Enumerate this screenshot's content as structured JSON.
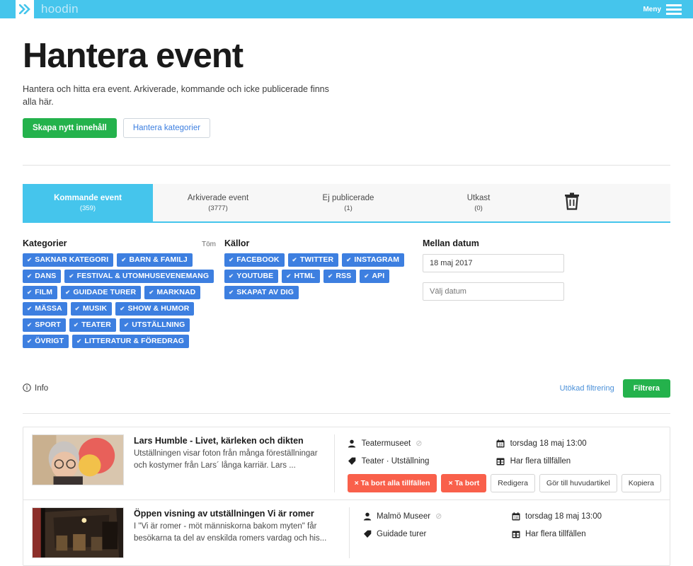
{
  "topbar": {
    "brand": "hoodin",
    "logo_icon": "double-chevron-icon",
    "menu_label": "Meny",
    "menu_icon": "hamburger-icon"
  },
  "header": {
    "title": "Hantera event",
    "subtitle": "Hantera och hitta era event. Arkiverade, kommande och icke publicerade finns alla här.",
    "primary_button": "Skapa nytt innehåll",
    "secondary_button": "Hantera kategorier"
  },
  "tabs": {
    "items": [
      {
        "label": "Kommande event",
        "count": "(359)",
        "active": true
      },
      {
        "label": "Arkiverade event",
        "count": "(3777)",
        "active": false
      },
      {
        "label": "Ej publicerade",
        "count": "(1)",
        "active": false
      },
      {
        "label": "Utkast",
        "count": "(0)",
        "active": false
      }
    ],
    "trash_icon": "trash-icon"
  },
  "filters": {
    "categories": {
      "heading": "Kategorier",
      "clear_label": "Töm",
      "tags": [
        "SAKNAR KATEGORI",
        "BARN & FAMILJ",
        "DANS",
        "FESTIVAL & UTOMHUSEVENEMANG",
        "FILM",
        "GUIDADE TURER",
        "MARKNAD",
        "MÄSSA",
        "MUSIK",
        "SHOW & HUMOR",
        "SPORT",
        "TEATER",
        "UTSTÄLLNING",
        "ÖVRIGT",
        "LITTERATUR & FÖREDRAG"
      ]
    },
    "sources": {
      "heading": "Källor",
      "tags": [
        "FACEBOOK",
        "TWITTER",
        "INSTAGRAM",
        "YOUTUBE",
        "HTML",
        "RSS",
        "API",
        "SKAPAT AV DIG"
      ]
    },
    "date": {
      "heading": "Mellan datum",
      "from_value": "18 maj 2017",
      "to_placeholder": "Välj datum"
    }
  },
  "actionbar": {
    "info_label": "Info",
    "info_icon": "info-circle-icon",
    "extended_filter_label": "Utökad filtrering",
    "filter_button": "Filtrera"
  },
  "results": [
    {
      "title": "Lars Humble - Livet, kärleken och dikten",
      "description": "Utställningen visar foton från många föreställningar och kostymer från Lars´ långa karriär. Lars ...",
      "thumb_alt": "portrait-thumbnail",
      "organizer": "Teatermuseet",
      "organizer_icon": "user-icon",
      "blocked_icon": "ban-icon",
      "categories": "Teater · Utställning",
      "category_icon": "tag-icon",
      "date": "torsdag 18 maj 13:00",
      "date_icon": "calendar-icon",
      "recurrence": "Har flera tillfällen",
      "recurrence_icon": "calendar-multiple-icon",
      "buttons": [
        {
          "label": "× Ta bort alla tillfällen",
          "style": "red"
        },
        {
          "label": "× Ta bort",
          "style": "red"
        },
        {
          "label": "Redigera",
          "style": "plain"
        },
        {
          "label": "Gör till huvudartikel",
          "style": "plain"
        },
        {
          "label": "Kopiera",
          "style": "plain"
        }
      ]
    },
    {
      "title": "Öppen visning av utställningen Vi är romer",
      "description": "I \"Vi är romer - möt människorna bakom myten\" får besökarna ta del av enskilda romers vardag och his...",
      "thumb_alt": "interior-thumbnail",
      "organizer": "Malmö Museer",
      "organizer_icon": "user-icon",
      "blocked_icon": "ban-icon",
      "categories": "Guidade turer",
      "category_icon": "tag-icon",
      "date": "torsdag 18 maj 13:00",
      "date_icon": "calendar-icon",
      "recurrence": "Har flera tillfällen",
      "recurrence_icon": "calendar-multiple-icon",
      "buttons": []
    }
  ],
  "colors": {
    "header_blue": "#45c5ec",
    "tag_blue": "#3d7fe0",
    "green": "#24b24c",
    "red": "#f9604b",
    "link_blue": "#4a90d9"
  }
}
